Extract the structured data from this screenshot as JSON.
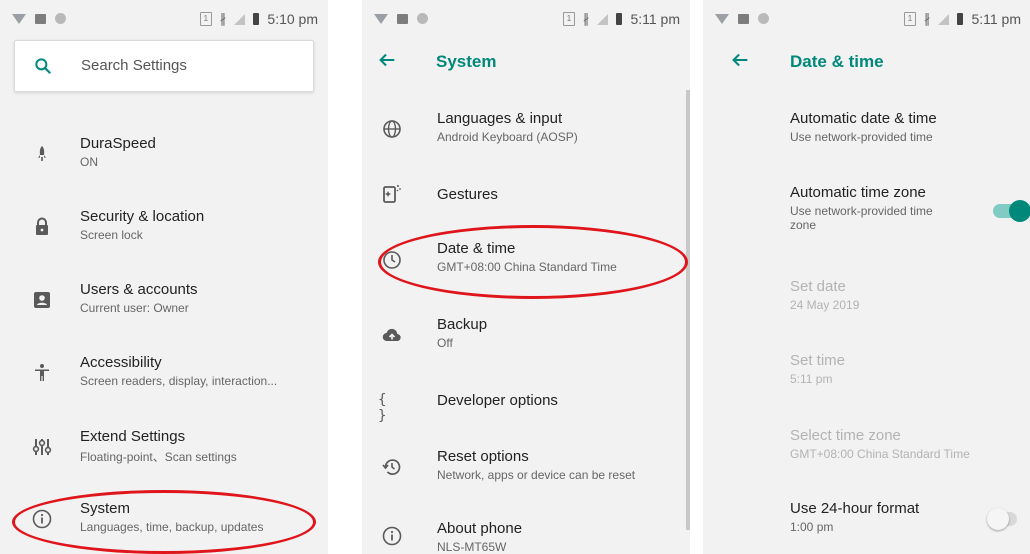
{
  "screen1": {
    "time": "5:10 pm",
    "search_placeholder": "Search Settings",
    "items": [
      {
        "primary": "DuraSpeed",
        "secondary": "ON"
      },
      {
        "primary": "Security & location",
        "secondary": "Screen lock"
      },
      {
        "primary": "Users & accounts",
        "secondary": "Current user: Owner"
      },
      {
        "primary": "Accessibility",
        "secondary": "Screen readers, display, interaction..."
      },
      {
        "primary": "Extend Settings",
        "secondary": "Floating-point、Scan settings"
      },
      {
        "primary": "System",
        "secondary": "Languages, time, backup, updates"
      }
    ]
  },
  "screen2": {
    "time": "5:11 pm",
    "title": "System",
    "items": [
      {
        "primary": "Languages & input",
        "secondary": "Android Keyboard (AOSP)"
      },
      {
        "primary": "Gestures"
      },
      {
        "primary": "Date & time",
        "secondary": "GMT+08:00 China Standard Time"
      },
      {
        "primary": "Backup",
        "secondary": "Off"
      },
      {
        "primary": "Developer options"
      },
      {
        "primary": "Reset options",
        "secondary": "Network, apps or device can be reset"
      },
      {
        "primary": "About phone",
        "secondary": "NLS-MT65W"
      }
    ]
  },
  "screen3": {
    "time": "5:11 pm",
    "title": "Date & time",
    "items": [
      {
        "primary": "Automatic date & time",
        "secondary": "Use network-provided time"
      },
      {
        "primary": "Automatic time zone",
        "secondary": "Use network-provided time",
        "secondary2": "zone",
        "toggle_on": true
      },
      {
        "primary": "Set date",
        "secondary": "24 May 2019"
      },
      {
        "primary": "Set time",
        "secondary": "5:11 pm"
      },
      {
        "primary": "Select time zone",
        "secondary": "GMT+08:00 China Standard Time"
      },
      {
        "primary": "Use 24-hour format",
        "secondary": "1:00 pm",
        "toggle_on": false
      }
    ]
  },
  "colors": {
    "accent": "#00897b",
    "highlight": "#e0151b",
    "background": "#f2f2f2"
  },
  "status_icons": [
    "wifi-icon",
    "image-icon",
    "circle-icon",
    "sim-icon",
    "bluetooth-icon",
    "signal-icon",
    "battery-icon"
  ]
}
